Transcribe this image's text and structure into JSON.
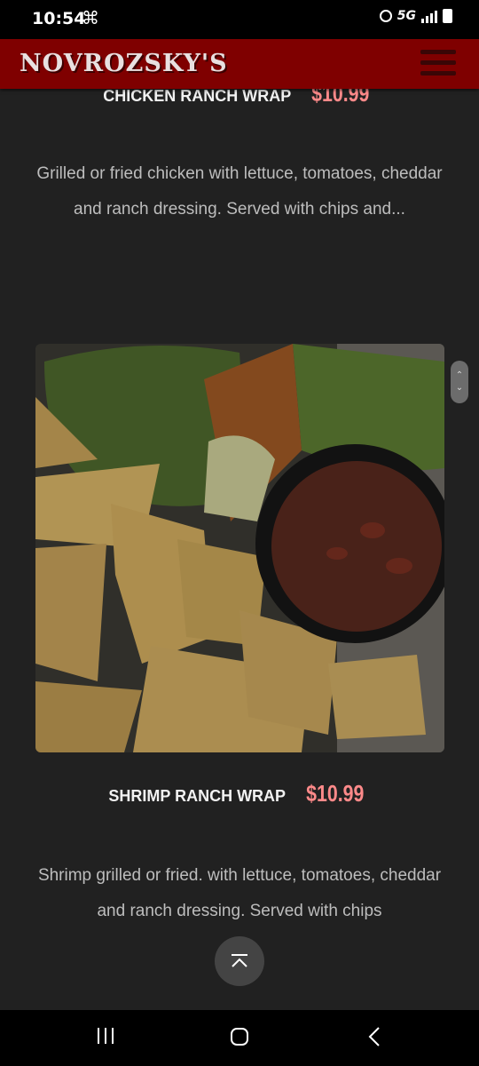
{
  "status": {
    "time": "10:54",
    "network": "5G"
  },
  "header": {
    "logo": "NOVROZSKY'S"
  },
  "items": [
    {
      "name": "CHICKEN RANCH WRAP",
      "price": "$10.99",
      "description": "Grilled or fried chicken with lettuce, tomatoes, cheddar and ranch dressing. Served with chips and..."
    },
    {
      "name": "SHRIMP RANCH WRAP",
      "price": "$10.99",
      "description": "Shrimp grilled or fried. with lettuce, tomatoes, cheddar and ranch dressing. Served with chips"
    }
  ],
  "colors": {
    "header_bg": "#7f0000",
    "price": "#ff8a8a",
    "page_bg": "#212121"
  },
  "icons": [
    "menu-icon",
    "scroll-to-top-icon",
    "recents-icon",
    "home-icon",
    "back-icon"
  ]
}
